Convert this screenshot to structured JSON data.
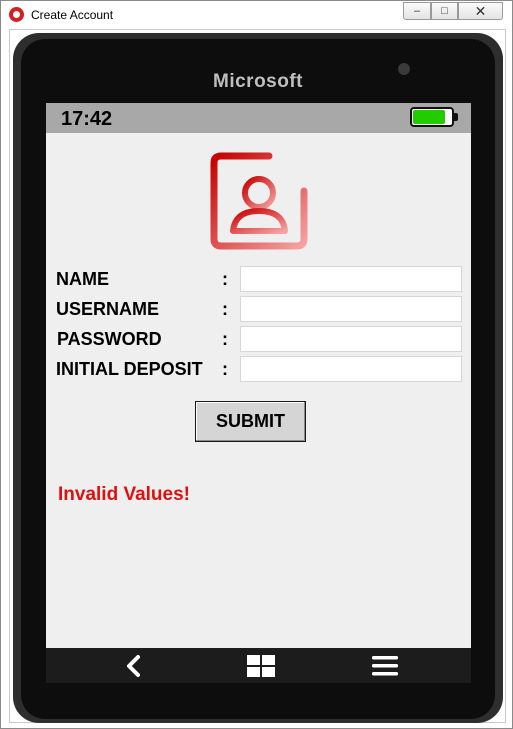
{
  "window": {
    "title": "Create Account",
    "controls": {
      "minimize": "‒",
      "maximize": "□",
      "close": "✕"
    }
  },
  "phone": {
    "brand": "Microsoft",
    "status_bar": {
      "time": "17:42",
      "battery_level": 0.85,
      "battery_color": "#22cc00"
    }
  },
  "form": {
    "icon": "add-user-icon",
    "fields": [
      {
        "label": "NAME",
        "colon": ":",
        "value": ""
      },
      {
        "label": "USERNAME",
        "colon": ":",
        "value": ""
      },
      {
        "label": "PASSWORD",
        "colon": ":",
        "value": ""
      },
      {
        "label": "INITIAL DEPOSIT",
        "colon": ":",
        "value": ""
      }
    ],
    "submit_label": "SUBMIT",
    "error_message": "Invalid Values!",
    "error_color": "#e01010"
  },
  "nav": {
    "back_icon": "back-icon",
    "start_icon": "windows-start-icon",
    "menu_icon": "menu-icon"
  }
}
